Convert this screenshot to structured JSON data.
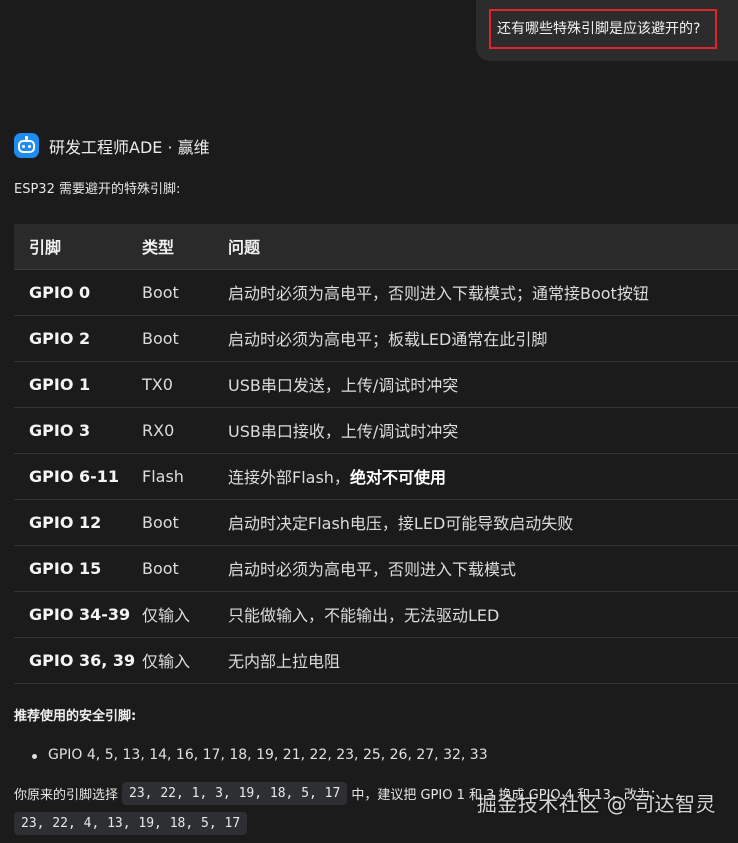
{
  "user_message": "还有哪些特殊引脚是应该避开的?",
  "assistant": {
    "name": "研发工程师ADE · 赢维",
    "intro": "ESP32 需要避开的特殊引脚:"
  },
  "table": {
    "headers": [
      "引脚",
      "类型",
      "问题"
    ],
    "rows": [
      {
        "pin": "GPIO 0",
        "type": "Boot",
        "issue": "启动时必须为高电平，否则进入下载模式；通常接Boot按钮",
        "issue_bold": ""
      },
      {
        "pin": "GPIO 2",
        "type": "Boot",
        "issue": "启动时必须为高电平；板载LED通常在此引脚",
        "issue_bold": ""
      },
      {
        "pin": "GPIO 1",
        "type": "TX0",
        "issue": "USB串口发送，上传/调试时冲突",
        "issue_bold": ""
      },
      {
        "pin": "GPIO 3",
        "type": "RX0",
        "issue": "USB串口接收，上传/调试时冲突",
        "issue_bold": ""
      },
      {
        "pin": "GPIO 6-11",
        "type": "Flash",
        "issue": "连接外部Flash，",
        "issue_bold": "绝对不可使用"
      },
      {
        "pin": "GPIO 12",
        "type": "Boot",
        "issue": "启动时决定Flash电压，接LED可能导致启动失败",
        "issue_bold": ""
      },
      {
        "pin": "GPIO 15",
        "type": "Boot",
        "issue": "启动时必须为高电平，否则进入下载模式",
        "issue_bold": ""
      },
      {
        "pin": "GPIO 34-39",
        "type": "仅输入",
        "issue": "只能做输入，不能输出，无法驱动LED",
        "issue_bold": ""
      },
      {
        "pin": "GPIO 36, 39",
        "type": "仅输入",
        "issue": "无内部上拉电阻",
        "issue_bold": ""
      }
    ]
  },
  "safe_section": {
    "title": "推荐使用的安全引脚:",
    "items": [
      "GPIO 4, 5, 13, 14, 16, 17, 18, 19, 21, 22, 23, 25, 26, 27, 32, 33"
    ]
  },
  "advice": {
    "prefix": "你原来的引脚选择",
    "original_code": "23, 22, 1, 3, 19, 18, 5, 17",
    "middle": "中，建议把 GPIO 1 和 3 换成 GPIO 4 和 13，改为：",
    "new_code": "23, 22, 4, 13, 19, 18, 5, 17"
  },
  "watermark": "掘金技术社区 @ 司达智灵"
}
